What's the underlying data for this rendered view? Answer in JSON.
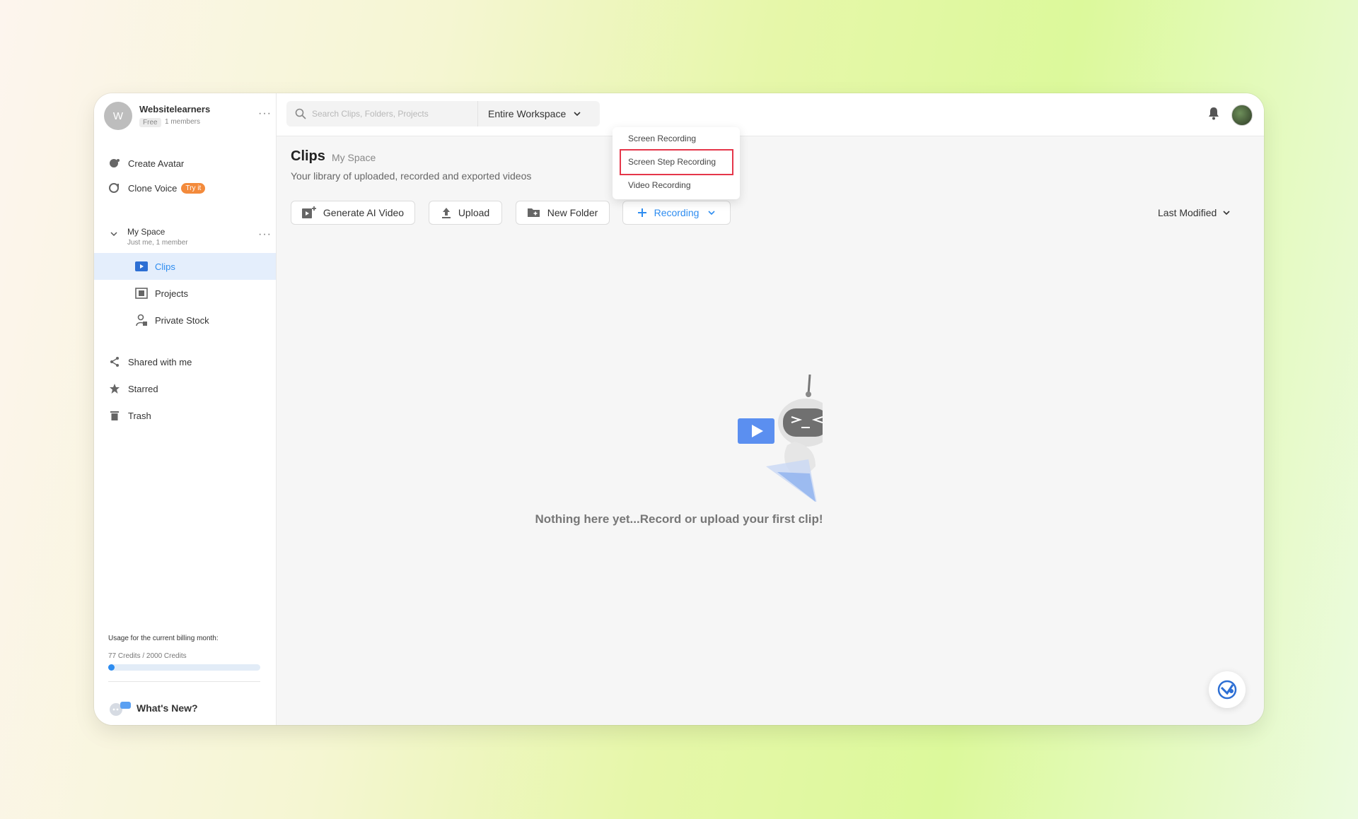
{
  "workspace": {
    "avatar_letter": "W",
    "name": "Websitelearners",
    "plan": "Free",
    "members": "1 members"
  },
  "sidebar": {
    "create_avatar": "Create Avatar",
    "clone_voice": "Clone Voice",
    "clone_voice_badge": "Try it",
    "my_space": {
      "title": "My Space",
      "subtitle": "Just me, 1 member",
      "items": [
        {
          "label": "Clips"
        },
        {
          "label": "Projects"
        },
        {
          "label": "Private Stock"
        }
      ]
    },
    "shared": "Shared with me",
    "starred": "Starred",
    "trash": "Trash",
    "usage": {
      "label": "Usage for the current billing month:",
      "credits_text": "77 Credits / 2000 Credits",
      "used": 77,
      "total": 2000
    },
    "whats_new": "What's New?"
  },
  "topbar": {
    "search_placeholder": "Search Clips, Folders, Projects",
    "scope": "Entire Workspace"
  },
  "main": {
    "title": "Clips",
    "subtitle": "My Space",
    "description": "Your library of uploaded, recorded and exported videos",
    "buttons": {
      "generate": "Generate AI Video",
      "upload": "Upload",
      "new_folder": "New Folder",
      "recording": "Recording"
    },
    "sort": "Last Modified",
    "empty_message": "Nothing here yet...Record or upload your first clip!"
  },
  "recording_menu": {
    "items": [
      "Screen Recording",
      "Screen Step Recording",
      "Video Recording"
    ],
    "highlighted": "Screen Step Recording"
  },
  "colors": {
    "accent": "#2d8cf0",
    "highlight_box": "#e5364a",
    "badge": "#f38a3b"
  }
}
